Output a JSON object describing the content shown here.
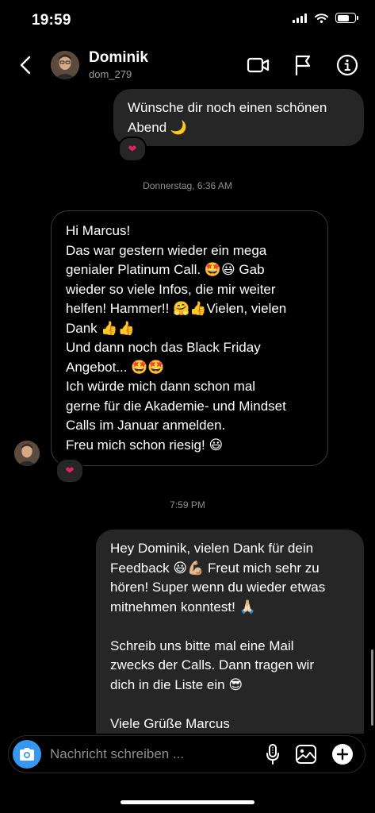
{
  "status_bar": {
    "time": "19:59",
    "battery_level_percent": 70
  },
  "header": {
    "name": "Dominik",
    "handle": "dom_279"
  },
  "messages": [
    {
      "direction": "outgoing",
      "text": "Wünsche dir noch einen schönen\nAbend 🌙",
      "reaction": "heart"
    },
    {
      "kind": "timestamp",
      "text": "Donnerstag, 6:36 AM"
    },
    {
      "direction": "incoming",
      "text": "Hi Marcus!\nDas war gestern wieder ein mega\ngenialer Platinum Call. 🤩😃 Gab\nwieder so viele Infos, die mir weiter\nhelfen! Hammer!! 🤗👍Vielen, vielen\nDank 👍👍\nUnd dann noch das Black Friday\nAngebot... 🤩🤩\nIch würde mich dann schon mal\ngerne für die Akademie- und Mindset\nCalls im Januar anmelden.\nFreu mich schon riesig! 😃",
      "reaction": "heart"
    },
    {
      "kind": "timestamp",
      "text": "7:59 PM"
    },
    {
      "direction": "outgoing",
      "text": "Hey Dominik, vielen Dank für dein\nFeedback 😃💪🏼 Freut mich sehr zu\nhören! Super wenn du wieder etwas\nmitnehmen konntest! 🙏🏻\n\nSchreib uns bitte mal eine Mail\nzwecks der Calls. Dann tragen wir\ndich in die Liste ein 😎\n\nViele Grüße Marcus"
    }
  ],
  "composer": {
    "placeholder": "Nachricht schreiben ..."
  },
  "icons": {
    "back": "chevron-left-icon",
    "video": "video-camera-icon",
    "report": "flag-icon",
    "info": "info-icon",
    "camera": "camera-icon",
    "mic": "microphone-icon",
    "gallery": "image-icon",
    "add": "plus-icon",
    "reaction": "heart-icon"
  },
  "colors": {
    "background": "#000000",
    "bubble_outgoing": "#262626",
    "camera_button": "#3797f0",
    "reaction_heart": "#e0245e"
  }
}
